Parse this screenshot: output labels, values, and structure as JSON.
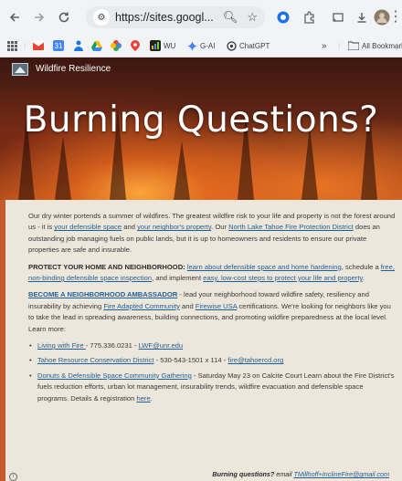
{
  "browser": {
    "url": "https://sites.googl...",
    "bookmarks": [
      {
        "label": "",
        "icon": "gmail-icon",
        "color": "#ea4335"
      },
      {
        "label": "",
        "icon": "calendar-icon",
        "color": "#4285f4"
      },
      {
        "label": "",
        "icon": "person-icon",
        "color": "#1a73e8"
      },
      {
        "label": "",
        "icon": "drive-icon",
        "color": "#0f9d58"
      },
      {
        "label": "",
        "icon": "photos-icon",
        "color": "#fbbc04"
      },
      {
        "label": "",
        "icon": "maps-icon",
        "color": "#ea4335"
      },
      {
        "label": "WU",
        "icon": "wu-icon",
        "color": "#222222"
      },
      {
        "label": "G-AI",
        "icon": "gemini-icon",
        "color": "#4285f4"
      },
      {
        "label": "ChatGPT",
        "icon": "chatgpt-icon",
        "color": "#333333"
      }
    ],
    "all_bookmarks": "All Bookmarks"
  },
  "site": {
    "name": "Wildfire Resilience",
    "hero_title": "Burning Questions?"
  },
  "p1": {
    "t1": "Our dry winter portends a summer of wildfires.  The greatest wildfire risk to your life and property is not the forest around us - it is ",
    "l1": "your defensible space",
    "t2": " and ",
    "l2": "your neighbor's property",
    "t3": ".  Our ",
    "l3": "North Lake Tahoe Fire Protection District",
    "t4": " does an outstanding job managing fuels on public lands, but it is up to homeowners and residents to ensure our private properties are safe and insurable."
  },
  "p2": {
    "bold": "PROTECT YOUR HOME AND NEIGHBORHOOD:",
    "sp": " ",
    "l1": "learn about defensible space and home hardening",
    "t1": ", schedule a ",
    "l2": "free, non-binding defensible space inspection",
    "t2": ", and implement ",
    "l3": "easy, low-cost steps to protect your life and property",
    "t3": "."
  },
  "p3": {
    "l0": "BECOME A NEIGHBORHOOD AMBASSADOR",
    "t1": " - lead your neighborhood toward wildfire safety, resiliency and insurability by achieving ",
    "l1": "Fire Adapted Community",
    "t2": " and ",
    "l2": "Firewise USA",
    "t3": " certifications.  We're looking for neighbors like you to take the lead in spreading awareness, building connections, and promoting wildfire preparedness at the local level.  Learn  more:"
  },
  "list": {
    "i1_link": "Living with Fire ",
    "i1_text": "- 775.336.0231 - ",
    "i1_email": "LWF@unr.edu",
    "i2_link": "Tahoe Resource Conservation  District",
    "i2_text": " - 530-543-1501 x 114 - ",
    "i2_email": "fire@tahoercd.org",
    "i3_link": "Donuts & Defensible Space Community Gathering",
    "i3_text": " - Saturday May 23 on Calcite Court Learn about the Fire District's fuels reduction efforts, urban lot management, insurability trends, wildfire evacuation and defensible space programs.  Details & registration ",
    "i3_here": "here",
    "i3_end": "."
  },
  "footer": {
    "bold": "Burning questions?",
    "text": "  email ",
    "email": "TMillhoff+InclineFire@gmail.com"
  },
  "colors": {
    "link": "#1f5f99",
    "accent": "#c65a2a"
  }
}
